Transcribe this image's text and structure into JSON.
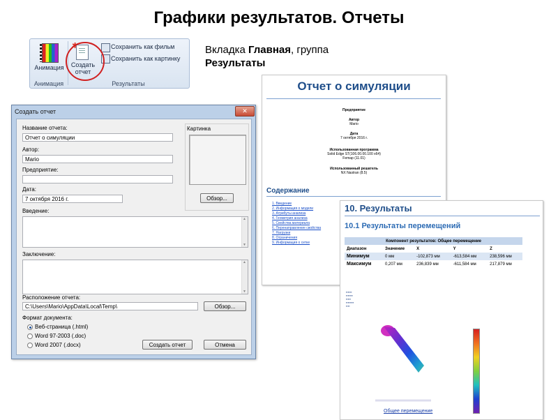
{
  "slide_title": "Графики результатов. Отчеты",
  "caption": {
    "prefix": "Вкладка ",
    "tab": "Главная",
    "middle": ", группа ",
    "group": "Результаты"
  },
  "ribbon": {
    "animation_button": "Анимация",
    "animation_group": "Анимация",
    "create_report_line1": "Создать",
    "create_report_line2": "отчет",
    "save_movie": "Сохранить как фильм",
    "save_picture": "Сохранить как картинку",
    "results_group": "Результаты"
  },
  "dialog": {
    "title": "Создать отчет",
    "close_glyph": "✕",
    "report_name_label": "Название отчета:",
    "report_name_value": "Отчет о симуляции",
    "author_label": "Автор:",
    "author_value": "Mario",
    "company_label": "Предприятие:",
    "company_value": "",
    "date_label": "Дата:",
    "date_value": "7 октября 2016 г.",
    "picture_label": "Картинка",
    "browse_picture": "Обзор...",
    "intro_label": "Введение:",
    "conclusion_label": "Заключение:",
    "location_label": "Расположение отчета:",
    "location_value": "C:\\Users\\Mario\\AppData\\Local\\Temp\\",
    "browse_location": "Обзор...",
    "format_label": "Формат документа:",
    "formats": [
      "Веб-страница (.html)",
      "Word 97-2003 (.doc)",
      "Word 2007 (.docx)"
    ],
    "selected_format": 0,
    "create_button": "Создать отчет",
    "cancel_button": "Отмена"
  },
  "report1": {
    "title": "Отчет о симуляции",
    "company_heading": "Предприятие",
    "author_heading": "Автор",
    "author_value": "Mario",
    "date_heading": "Дата",
    "date_value": "7 октября 2016 г.",
    "program_heading": "Использованная программа",
    "program_value": "Solid Edge ST(106.00.00.100 x64)",
    "program_extra": "Femap (11.01)",
    "solver_heading": "Использованный решатель",
    "solver_value": "NX Nastran (8.5)",
    "toc_title": "Содержание",
    "toc": [
      "1. Введение",
      "2. Информация о модели",
      "3. Атрибуты анализа",
      "4. Геометрия анализа",
      "5. Свойства материала",
      "6. Перенаправление свойства",
      "7. Нагрузки",
      "8. Ограничения",
      "9. Информация о сетке"
    ]
  },
  "report2": {
    "h1": "10. Результаты",
    "h2": "10.1 Результаты перемещений",
    "table_caption": "Компонент результатов: Общее перемещение",
    "headers": [
      "Диапазон",
      "Значение",
      "X",
      "Y",
      "Z"
    ],
    "rows": [
      [
        "Минимум",
        "0 мм",
        "-102,873 мм",
        "-613,584 мм",
        "238,596 мм"
      ],
      [
        "Максимум",
        "0,207 мм",
        "236,839 мм",
        "-611,584 мм",
        "217,879 мм"
      ]
    ],
    "figure_caption": "Общее перемещение"
  },
  "colors": {
    "title_blue": "#1f4e8a",
    "link_blue": "#1a4fc8",
    "highlight_red": "#d02020",
    "ribbon_bg": "#dfe8f4"
  }
}
